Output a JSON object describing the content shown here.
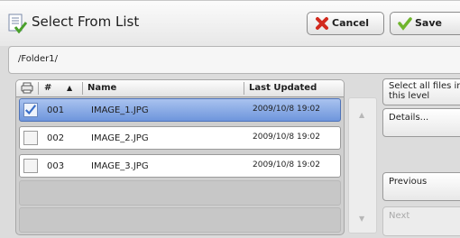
{
  "window": {
    "title": "Select From List",
    "cancel_label": "Cancel",
    "save_label": "Save",
    "cancel_icon": "red-x-icon",
    "save_icon": "green-check-icon"
  },
  "path": "/Folder1/",
  "list": {
    "columns": [
      "#",
      "Name",
      "Last Updated"
    ],
    "sort_indicator": "▲",
    "rows": [
      {
        "num": "001",
        "name": "IMAGE_1.JPG",
        "updated": "2009/10/8 19:02",
        "checked": true
      },
      {
        "num": "002",
        "name": "IMAGE_2.JPG",
        "updated": "2009/10/8 19:02",
        "checked": false
      },
      {
        "num": "003",
        "name": "IMAGE_3.JPG",
        "updated": "2009/10/8 19:02",
        "checked": false
      }
    ]
  },
  "scroll": {
    "up": "▲",
    "down": "▼"
  },
  "side": {
    "select_all": "Select all files in this level",
    "details": "Details...",
    "previous": "Previous",
    "next": "Next"
  },
  "colors": {
    "selected_row": "#7ea2e2",
    "background": "#dcdcdc"
  }
}
